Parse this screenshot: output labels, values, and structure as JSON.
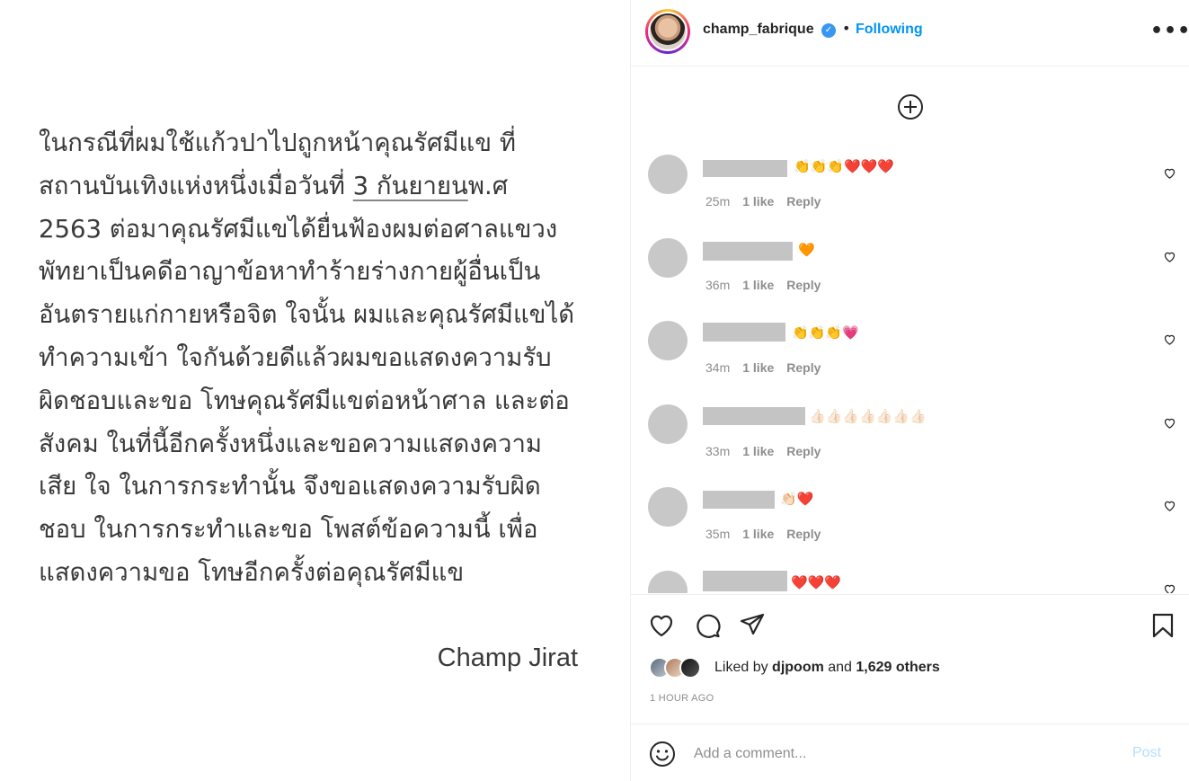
{
  "post_image": {
    "lines": [
      "ในกรณีที่ผมใช้แก้วปาไปถูกหน้าคุณรัศมีแข ที่",
      "สถานบันเทิงแห่งหนึ่งเมื่อวันที่ ",
      "3 กันยายน",
      "พ.ศ",
      "2563 ต่อมาคุณรัศมีแขได้ยื่นฟ้องผมต่อศาลแขวง",
      "พัทยาเป็นคดีอาญาข้อหาทำร้ายร่างกายผู้อื่นเป็น",
      "อันตรายแก่กายหรือจิต ใจนั้น ผมและคุณรัศมีแขได้",
      "ทำความเข้า ใจกันด้วยดีแล้วผมขอแสดงความรับ",
      "ผิดชอบและขอ โทษคุณรัศมีแขต่อหน้าศาล และต่อ",
      "สังคม ในที่นี้อีกครั้งหนึ่งและขอความแสดงความ",
      "เสีย ใจ ในการกระทำนั้น จึงขอแสดงความรับผิด",
      "ชอบ ในการกระทำและขอ โพสต์ข้อความนี้ เพื่อ",
      "แสดงความขอ โทษอีกครั้งต่อคุณรัศมีแข"
    ],
    "signature": "Champ Jirat"
  },
  "header": {
    "username": "champ_fabrique",
    "verified_icon": "verified-badge-icon",
    "separator": "•",
    "follow_label": "Following",
    "more_label": "•••"
  },
  "comments": [
    {
      "emoji": "👏👏👏❤️❤️❤️",
      "time": "25m",
      "likes": "1 like",
      "reply": "Reply"
    },
    {
      "emoji": "🧡",
      "time": "36m",
      "likes": "1 like",
      "reply": "Reply"
    },
    {
      "emoji": "👏👏👏💗",
      "time": "34m",
      "likes": "1 like",
      "reply": "Reply"
    },
    {
      "emoji": "👍🏻👍🏻👍🏻👍🏻👍🏻👍🏻👍🏻",
      "time": "33m",
      "likes": "1 like",
      "reply": "Reply"
    },
    {
      "emoji": "👏🏻❤️",
      "time": "35m",
      "likes": "1 like",
      "reply": "Reply"
    },
    {
      "emoji": "❤️❤️❤️",
      "time": "",
      "likes": "",
      "reply": ""
    }
  ],
  "likes": {
    "prefix": "Liked by ",
    "user": "djpoom",
    "middle": " and ",
    "others": "1,629 others"
  },
  "timestamp": "1 HOUR AGO",
  "comment_box": {
    "placeholder": "Add a comment...",
    "post_label": "Post"
  },
  "colors": {
    "accent": "#0095f6",
    "post_disabled": "#b2dffc",
    "muted": "#8e8e8e"
  }
}
